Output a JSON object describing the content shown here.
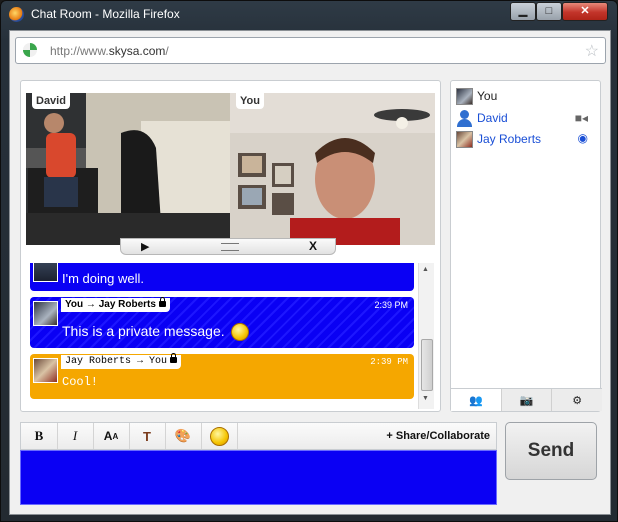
{
  "window": {
    "title": "Chat Room - Mozilla Firefox",
    "controls": {
      "minimize": "▁",
      "maximize": "□",
      "close": "✕"
    }
  },
  "browser": {
    "url_prefix": "http://www.",
    "url_domain": "skysa.com",
    "url_suffix": "/"
  },
  "video": {
    "left_label": "David",
    "right_label": "You",
    "controls": {
      "play": "▶",
      "close": "X"
    }
  },
  "messages": [
    {
      "sender_line": "",
      "text": "I'm doing well.",
      "time": ""
    },
    {
      "sender_line": "You → Jay Roberts",
      "private": true,
      "time": "2:39 PM",
      "text": "This is a private message."
    },
    {
      "sender_line": "Jay Roberts → You",
      "private": true,
      "time": "2:39 PM",
      "text": "Cool!"
    }
  ],
  "users": [
    {
      "name": "You",
      "color": "#222222"
    },
    {
      "name": "David",
      "color": "#1a4fd6",
      "status_icon": "video-camera-icon"
    },
    {
      "name": "Jay Roberts",
      "color": "#1a4fd6",
      "status_icon": "eye-icon"
    }
  ],
  "user_tabs": [
    "people-icon",
    "camera-icon",
    "settings-gear-icon"
  ],
  "toolbar": {
    "bold": "B",
    "italic": "I",
    "share_label": "+ Share/Collaborate"
  },
  "send_label": "Send",
  "colors": {
    "own_message": "#0a00f4",
    "other_message": "#f5a700",
    "input_bg": "#0a00f4"
  }
}
